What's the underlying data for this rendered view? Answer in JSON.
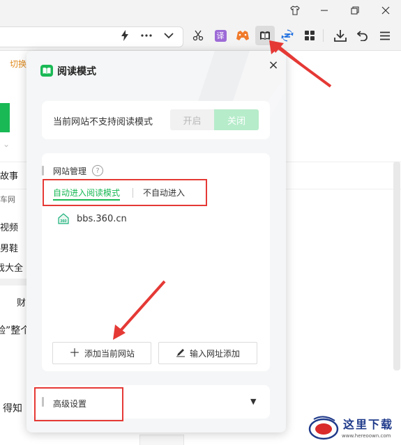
{
  "browser": {
    "window_controls": [
      "tshirt-icon",
      "minimize-icon",
      "restore-icon",
      "close-icon"
    ],
    "toolbar_icons": [
      "lightning-icon",
      "more-icon",
      "chevron-down-icon",
      "scissors-icon",
      "translate-icon",
      "game-icon",
      "reader-mode-icon",
      "sync-icon",
      "apps-grid-icon",
      "download-icon",
      "undo-icon",
      "menu-icon"
    ],
    "translate_icon_label": "译"
  },
  "background_page": {
    "tab_fragment": "切换",
    "left_items": [
      "故事",
      "车网",
      "视频",
      "男鞋",
      "戏大全"
    ],
    "fragment_right": "财",
    "fragment_quote": "验”整个",
    "fragment_bottom": "得知"
  },
  "popup": {
    "title": "阅读模式",
    "close_label": "×",
    "status_text": "当前网站不支持阅读模式",
    "switch": {
      "on_label": "开启",
      "off_label": "关闭",
      "selected": "关闭"
    },
    "site_management": {
      "title": "网站管理",
      "help_label": "?",
      "tabs": [
        {
          "label": "自动进入阅读模式",
          "active": true
        },
        {
          "label": "不自动进入",
          "active": false
        }
      ],
      "sites": [
        {
          "icon": "site-360-icon",
          "icon_text": "360",
          "name": "bbs.360.cn"
        }
      ],
      "add_current_button": "添加当前网站",
      "add_url_button": "输入网址添加"
    },
    "advanced": {
      "title": "高级设置",
      "caret": "▼"
    }
  },
  "watermark": {
    "text": "这里下载",
    "url": "www.hereoown.com"
  },
  "colors": {
    "accent_green": "#19b955",
    "annotation_red": "#e53935",
    "switch_off_bg": "#b6ecca"
  }
}
